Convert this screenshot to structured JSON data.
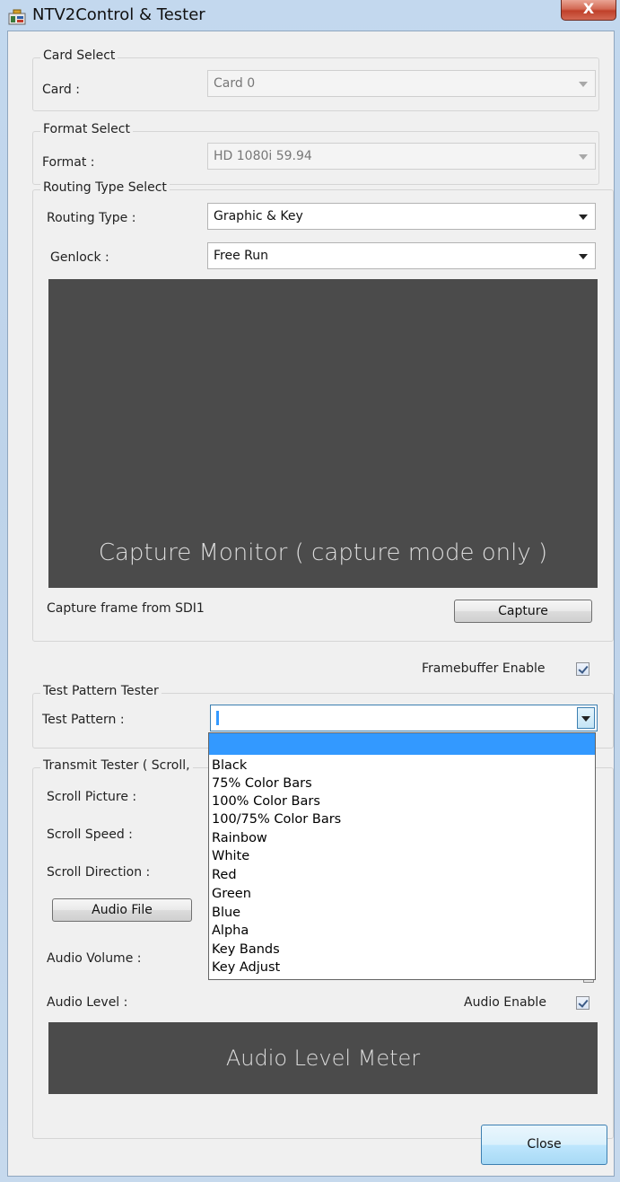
{
  "window": {
    "title": "NTV2Control & Tester",
    "close_glyph": "X"
  },
  "card_select": {
    "group": "Card Select",
    "label": "Card :",
    "value": "Card 0"
  },
  "format_select": {
    "group": "Format Select",
    "label": "Format :",
    "value": "HD 1080i 59.94"
  },
  "routing": {
    "group": "Routing Type Select",
    "routing_label": "Routing Type :",
    "routing_value": "Graphic & Key",
    "genlock_label": "Genlock :",
    "genlock_value": "Free Run",
    "monitor_text": "Capture Monitor ( capture mode only )",
    "capture_from": "Capture frame from SDI1",
    "capture_button": "Capture"
  },
  "framebuffer": {
    "label": "Framebuffer Enable",
    "checked": true
  },
  "test_pattern": {
    "group": "Test Pattern Tester",
    "label": "Test Pattern :",
    "options": [
      "Black",
      "75% Color Bars",
      "100% Color Bars",
      "100/75% Color Bars",
      "Rainbow",
      "White",
      "Red",
      "Green",
      "Blue",
      "Alpha",
      "Key Bands",
      "Key Adjust"
    ]
  },
  "transmit": {
    "group": "Transmit Tester ( Scroll,",
    "scroll_picture": "Scroll Picture :",
    "scroll_speed": "Scroll Speed :",
    "scroll_direction": "Scroll Direction :",
    "audio_file_button": "Audio File",
    "audio_volume": "Audio Volume :",
    "audio_level": "Audio Level :",
    "audio_enable": "Audio Enable",
    "audio_enable_checked": true,
    "meter_text": "Audio Level Meter"
  },
  "footer": {
    "close_button": "Close"
  },
  "icons": {
    "app": "app-window-icon",
    "close": "close-icon",
    "dropdown": "chevron-down-icon"
  }
}
